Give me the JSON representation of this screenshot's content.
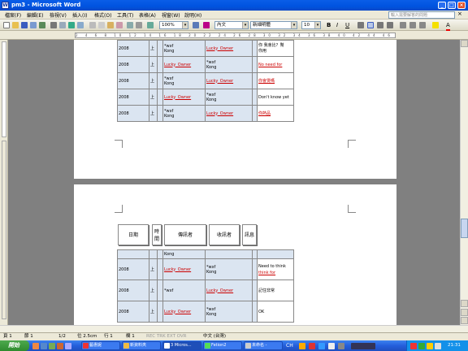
{
  "window": {
    "title": "pm3 - Microsoft Word",
    "controls": [
      "_",
      "□",
      "×"
    ]
  },
  "menu": {
    "items": [
      "檔案(F)",
      "編輯(E)",
      "檢視(V)",
      "插入(I)",
      "格式(O)",
      "工具(T)",
      "表格(A)",
      "視窗(W)",
      "說明(H)"
    ],
    "help_placeholder": "輸入需要解答的問題",
    "close": "×"
  },
  "toolbar": {
    "zoom": "100%",
    "style": "內文",
    "font": "新細明體",
    "size": "10",
    "bold": "B",
    "italic": "I",
    "underline": "U",
    "font_color_label": "A"
  },
  "ruler": {
    "marks": "2 4 6 8 10 12 14 16 18 20 22 24 26 28 30 32 34 36 38 40 42 44 46 48"
  },
  "table1": {
    "rows": [
      {
        "date": "2008",
        "c2": "上",
        "c3": "*wxf",
        "c3b": "Kong",
        "c4": "Lucky_Owner",
        "c5": "",
        "c5b": "",
        "c6": "你 我會比？幫",
        "c6b": "你用"
      },
      {
        "date": "2008",
        "c2": "上",
        "c3": "Lucky_Owner",
        "c3b": "",
        "c4": "*wxf",
        "c5": "Kong",
        "c5b": "",
        "c6": "No need for",
        "c6b": ""
      },
      {
        "date": "2008",
        "c2": "上",
        "c3": "*wxf",
        "c3b": "Kong",
        "c4": "Lucky_Owner",
        "c5": "",
        "c5b": "",
        "c6": "你會煲嗎",
        "c6b": ""
      },
      {
        "date": "2008",
        "c2": "上",
        "c3": "Lucky_Owner",
        "c3b": "",
        "c4": "*wxf",
        "c5": "Kong",
        "c5b": "",
        "c6": "Don't know yet",
        "c6b": ""
      },
      {
        "date": "2008",
        "c2": "上",
        "c3": "*wxf",
        "c3b": "Kong",
        "c4": "Lucky_Owner",
        "c5": "",
        "c5b": "",
        "c6": "你熱品",
        "c6b": ""
      }
    ]
  },
  "table2": {
    "headers": {
      "date": "日期",
      "time": "時間",
      "sender": "傳訊者",
      "receiver": "收訊者",
      "message": "訊息"
    },
    "rows": [
      {
        "date": "",
        "c2": "",
        "c3": "Kong",
        "c4": "",
        "c5": "",
        "c6": ""
      },
      {
        "date": "2008",
        "c2": "上",
        "c3": "Lucky_Owner",
        "c4": "*wxf",
        "c5": "Kong",
        "c6": "Need to think",
        "c6b": "think for"
      },
      {
        "date": "2008",
        "c2": "上",
        "c3": "*wxf",
        "c4": "Lucky_Owner",
        "c5": "",
        "c6": "記住非常"
      },
      {
        "date": "2008",
        "c2": "上",
        "c3": "Lucky_Owner",
        "c4": "*wxf",
        "c5": "Kong",
        "c6": "OK"
      }
    ]
  },
  "status": {
    "page": "頁 1",
    "section": "節 1",
    "pages": "1/2",
    "pos": "位 2.5cm",
    "line": "行 1",
    "col": "欄 1",
    "modes": "REC TRK EXT OVR",
    "lang": "中文 (台灣)"
  },
  "taskbar": {
    "start": "開始",
    "tasks": [
      "藝惠妮",
      "新資料夾",
      "3 Micros...",
      "Fetion2",
      "未命名 -"
    ],
    "tray_text": "CH",
    "clock": "21:31"
  }
}
